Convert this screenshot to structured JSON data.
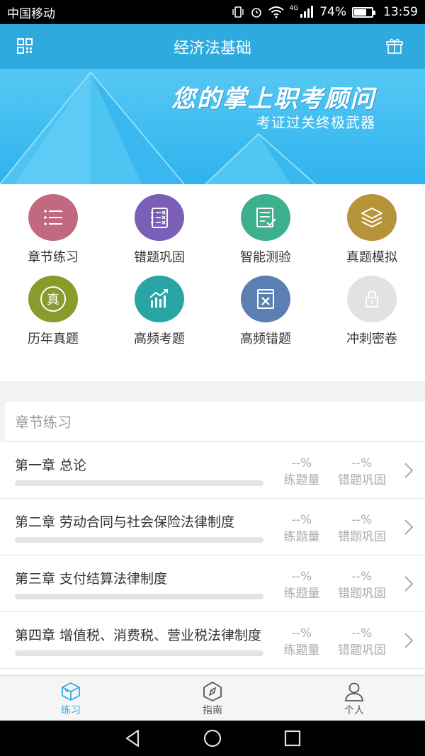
{
  "status_bar": {
    "carrier": "中国移动",
    "network": "4G",
    "battery": "74%",
    "battery_level": 0.74,
    "time": "13:59",
    "icons": [
      "vibrate-icon",
      "alarm-icon",
      "wifi-icon",
      "signal-icon",
      "battery-icon"
    ]
  },
  "header": {
    "title": "经济法基础",
    "left_icon": "grid-menu-icon",
    "right_icon": "gift-icon"
  },
  "banner": {
    "slogan": "您的掌上职考顾问",
    "subslogan": "考证过关终极武器"
  },
  "features": [
    {
      "label": "章节练习",
      "icon": "list-icon",
      "color": "#c1697f"
    },
    {
      "label": "错题巩固",
      "icon": "notebook-icon",
      "color": "#7b5fb7"
    },
    {
      "label": "智能测验",
      "icon": "check-document-icon",
      "color": "#3fb08e"
    },
    {
      "label": "真题模拟",
      "icon": "layers-icon",
      "color": "#b7943a"
    },
    {
      "label": "历年真题",
      "icon": "zhen-seal-icon",
      "color": "#8a9a2b"
    },
    {
      "label": "高频考题",
      "icon": "bar-trend-icon",
      "color": "#2aa5a5"
    },
    {
      "label": "高频错题",
      "icon": "book-x-icon",
      "color": "#5a7fb3"
    },
    {
      "label": "冲刺密卷",
      "icon": "lock-icon",
      "color": "#e2e2e2",
      "locked": true
    }
  ],
  "chapter_section": {
    "title": "章节练习",
    "stat_label_1": "练题量",
    "stat_label_2": "错题巩固",
    "chapters": [
      {
        "title": "第一章 总论",
        "progress": 0,
        "stat1": "--%",
        "stat2": "--%"
      },
      {
        "title": "第二章 劳动合同与社会保险法律制度",
        "progress": 0,
        "stat1": "--%",
        "stat2": "--%"
      },
      {
        "title": "第三章 支付结算法律制度",
        "progress": 0,
        "stat1": "--%",
        "stat2": "--%"
      },
      {
        "title": "第四章 增值税、消费税、营业税法律制度",
        "progress": 0,
        "stat1": "--%",
        "stat2": "--%"
      }
    ]
  },
  "tabs": [
    {
      "label": "练习",
      "icon": "cube-icon",
      "active": true
    },
    {
      "label": "指南",
      "icon": "compass-icon",
      "active": false
    },
    {
      "label": "个人",
      "icon": "person-icon",
      "active": false
    }
  ],
  "colors": {
    "primary": "#2eaadf",
    "banner": "#42bdf0"
  }
}
